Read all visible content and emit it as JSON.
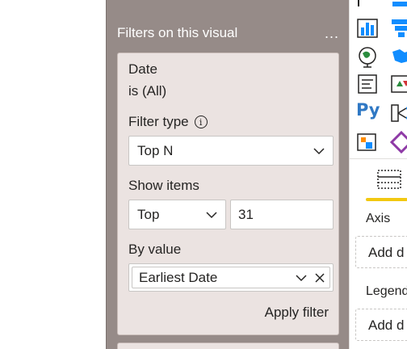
{
  "filters_pane": {
    "title": "Filters on this visual",
    "more_label": "...",
    "card": {
      "field": "Date",
      "state": "is (All)",
      "filter_type_label": "Filter type",
      "filter_type_value": "Top N",
      "show_items_label": "Show items",
      "show_items_direction": "Top",
      "show_items_count": "31",
      "by_value_label": "By value",
      "by_value_field": "Earliest Date",
      "apply_label": "Apply filter"
    }
  },
  "viz_pane": {
    "axis_label": "Axis",
    "axis_add": "Add d",
    "legend_label": "Legend",
    "legend_add": "Add d",
    "icons": [
      "line-chart-icon",
      "bar-chart-icon",
      "waterfall-icon",
      "funnel-icon",
      "globe-map-icon",
      "filled-map-icon",
      "card-icon",
      "kpi-icon",
      "python-visual-icon",
      "decomposition-tree-icon",
      "custom-visual-icon",
      "power-apps-icon",
      "fields-tab-icon"
    ],
    "accent": "#f2c811"
  }
}
